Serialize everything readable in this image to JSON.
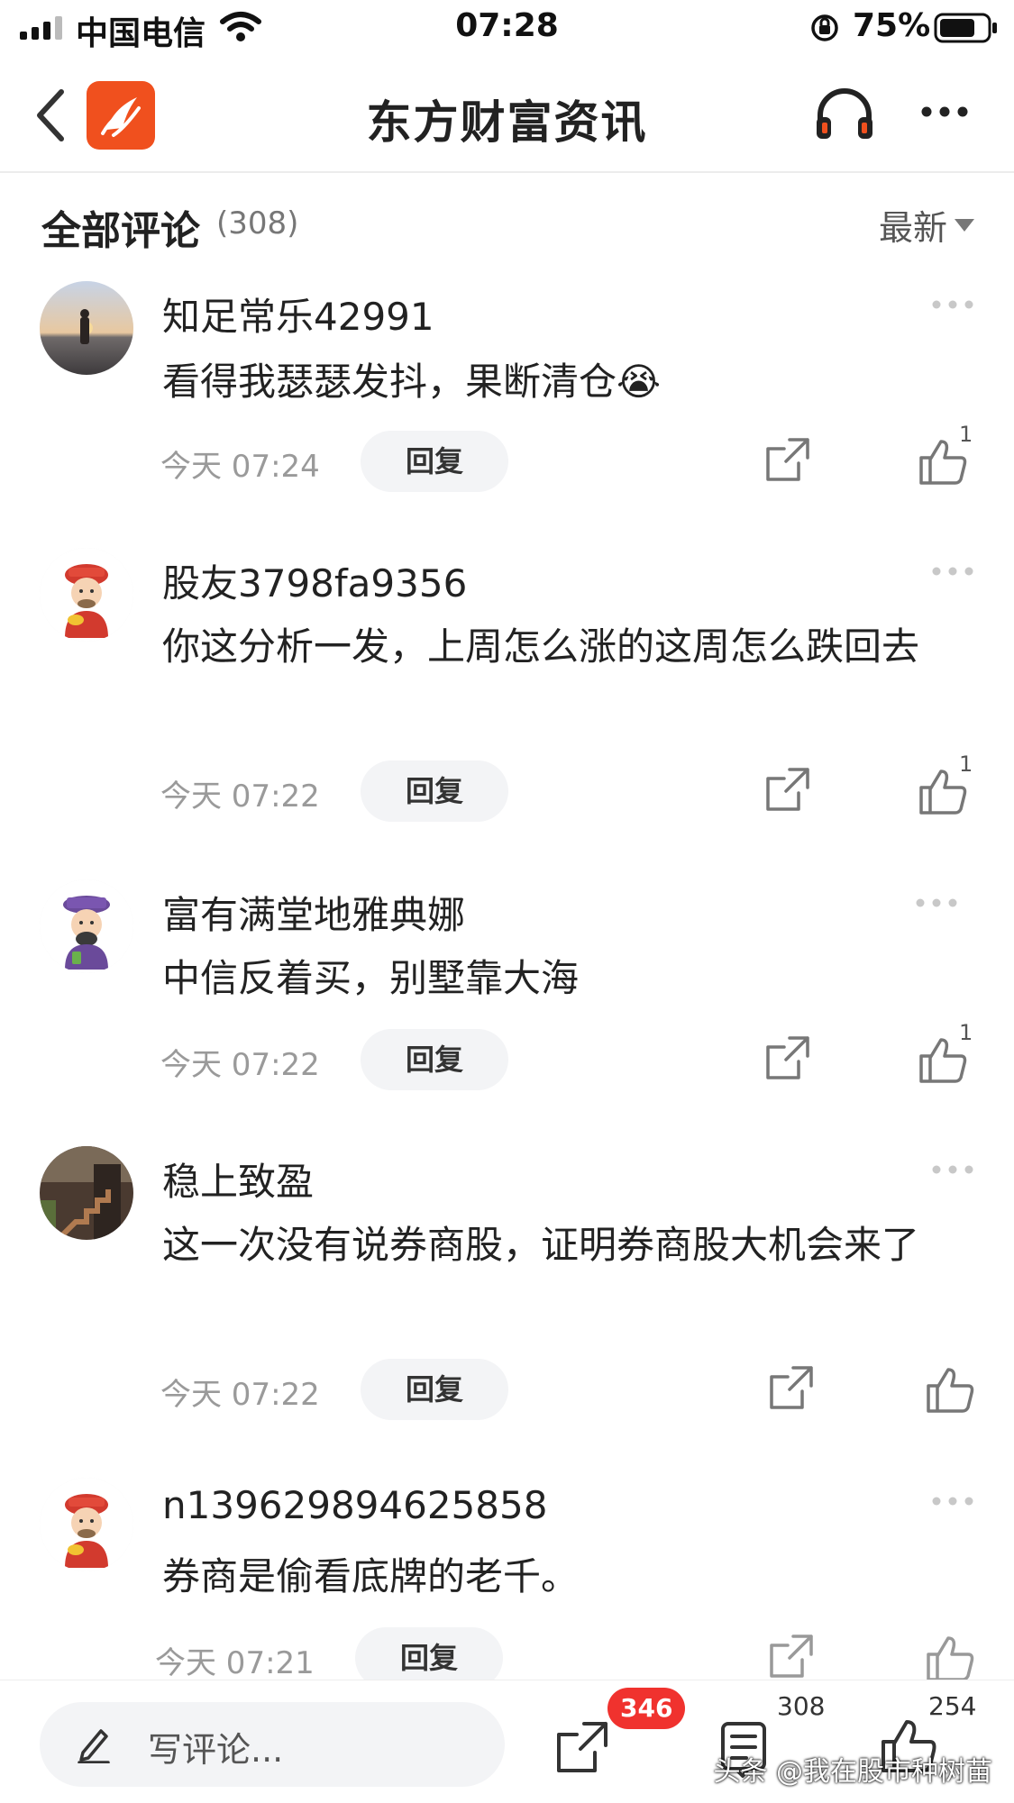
{
  "status_bar": {
    "carrier": "中国电信",
    "time": "07:28",
    "battery_percent": "75%",
    "battery_level": 0.75
  },
  "nav": {
    "title": "东方财富资讯",
    "logo_color": "#f0501e"
  },
  "section": {
    "title": "全部评论",
    "count": "(308)",
    "sort_label": "最新"
  },
  "comments": [
    {
      "username": "知足常乐42991",
      "text": "看得我瑟瑟发抖，果断清仓😭",
      "time": "今天 07:24",
      "reply_label": "回复",
      "like_count": "1"
    },
    {
      "username": "股友3798fa9356",
      "text": "你这分析一发，上周怎么涨的这周怎么跌回去",
      "time": "今天 07:22",
      "reply_label": "回复",
      "like_count": "1"
    },
    {
      "username": "富有满堂地雅典娜",
      "text": "中信反着买，别墅靠大海",
      "time": "今天 07:22",
      "reply_label": "回复",
      "like_count": "1"
    },
    {
      "username": "稳上致盈",
      "text": "这一次没有说券商股，证明券商股大机会来了",
      "time": "今天 07:22",
      "reply_label": "回复",
      "like_count": ""
    },
    {
      "username": "n139629894625858",
      "text": "券商是偷看底牌的老千。",
      "time": "今天 07:21",
      "reply_label": "回复",
      "like_count": ""
    }
  ],
  "bottom_bar": {
    "compose_placeholder": "写评论...",
    "share_badge": "346",
    "comment_count": "308",
    "like_count": "254",
    "watermark": "头条 @我在股市种树苗",
    "accent_color": "#f0322e"
  }
}
